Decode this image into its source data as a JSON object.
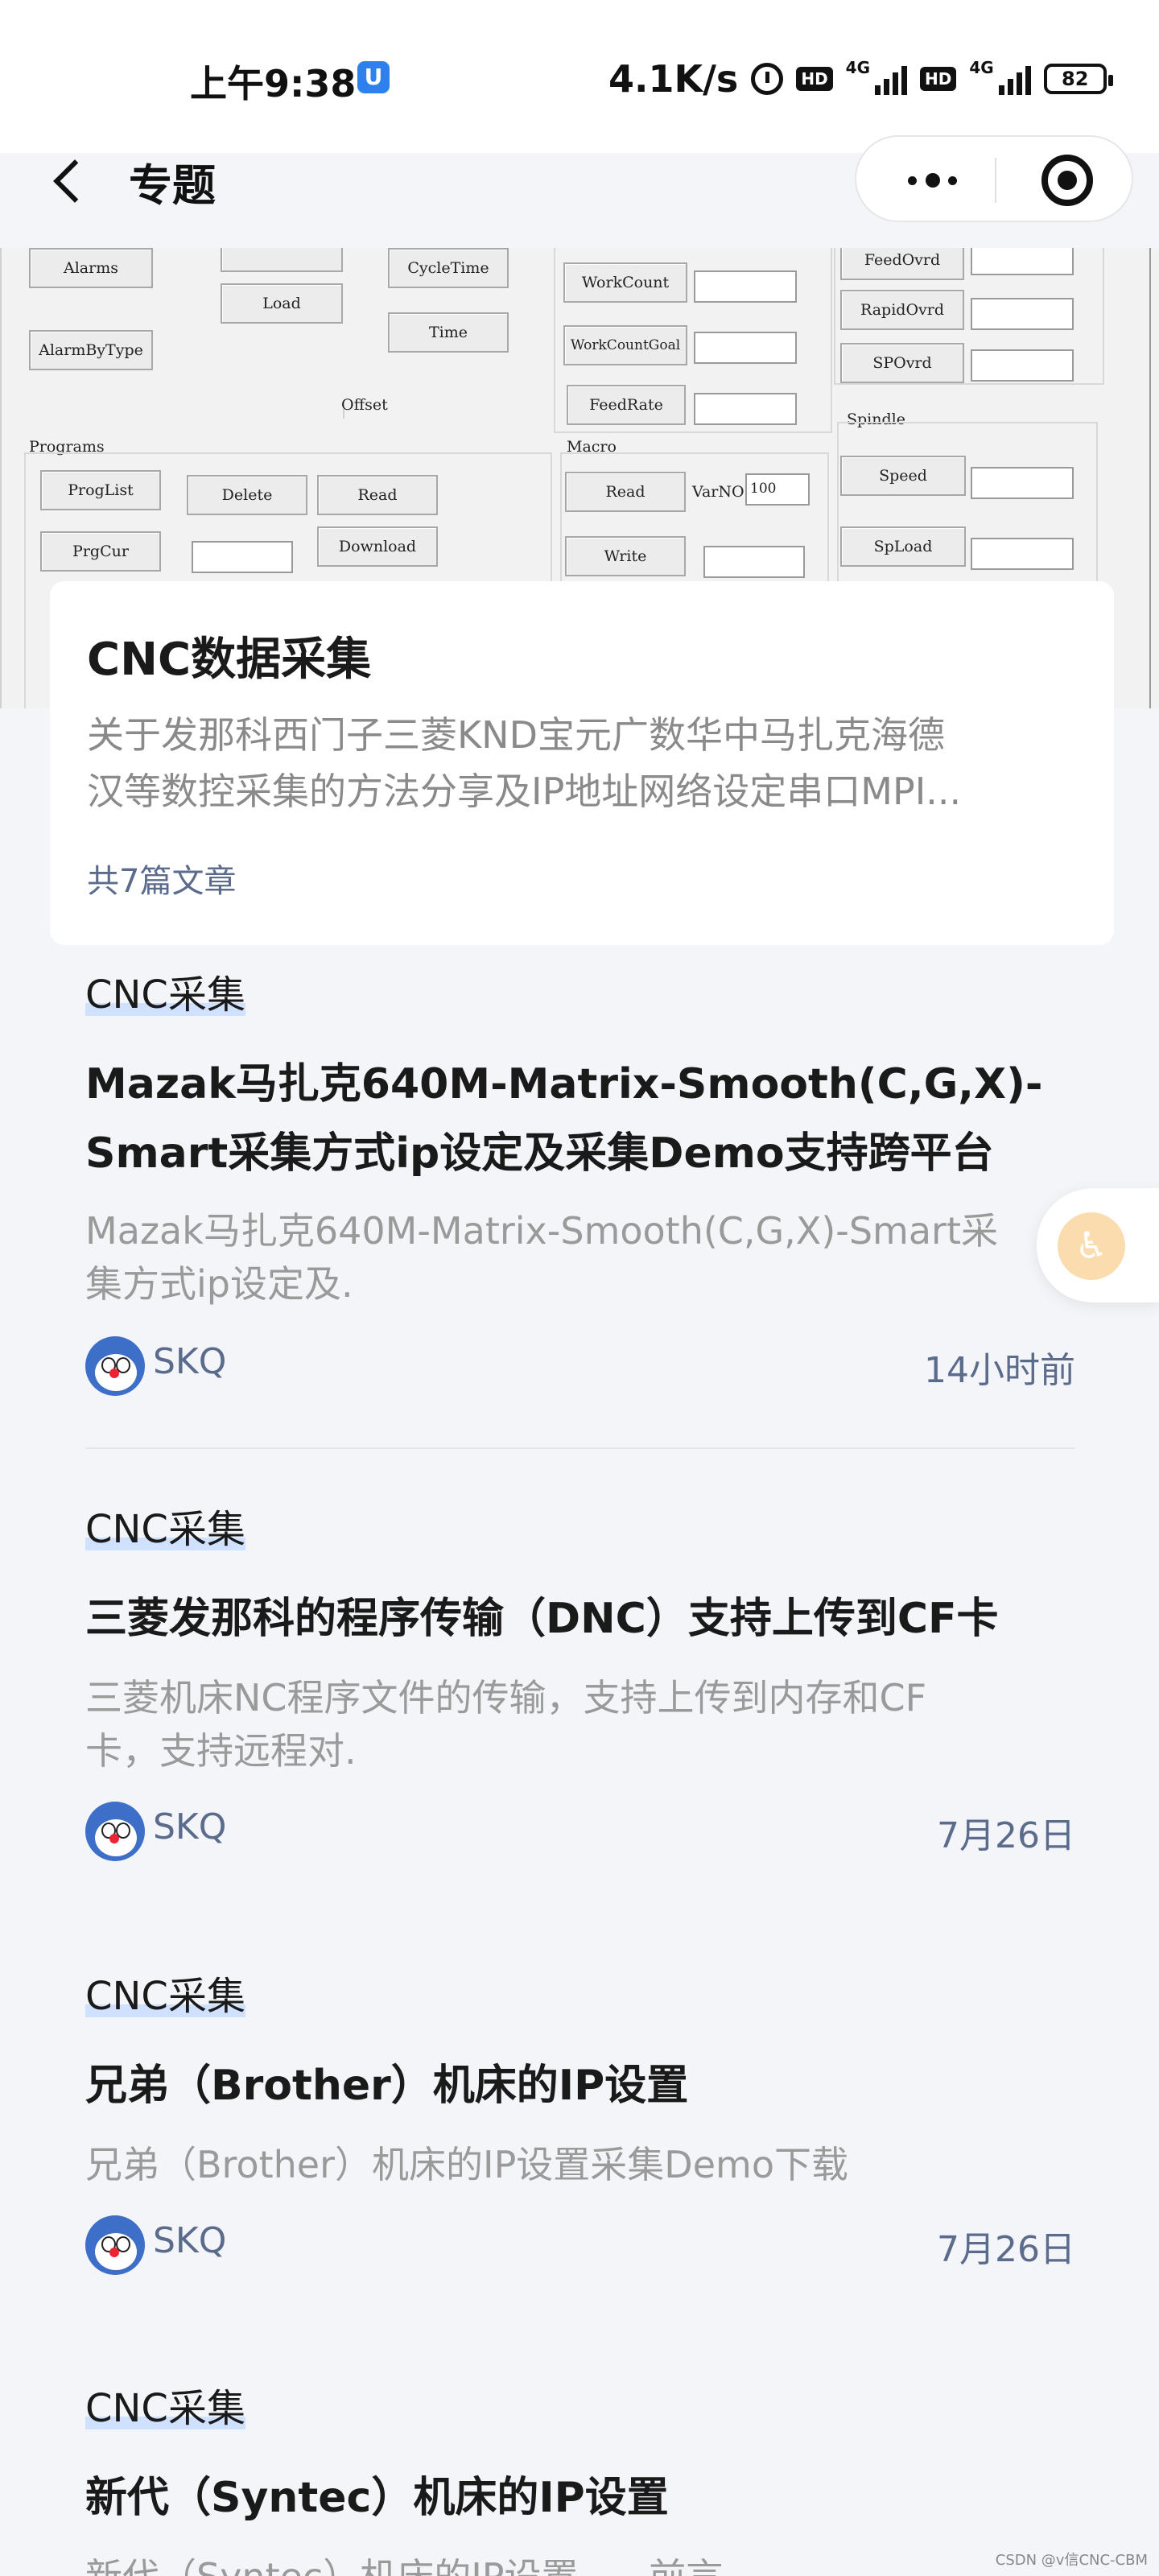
{
  "status_bar": {
    "time": "上午9:38",
    "app_badge": "U",
    "net_speed": "4.1K/s",
    "hd1": "HD",
    "net1": "4G",
    "hd2": "HD",
    "net2": "4G",
    "battery": "82"
  },
  "nav": {
    "title": "专题",
    "more_icon": "more-dots-icon",
    "close_icon": "target-circle-icon"
  },
  "banner": {
    "buttons": [
      "Alarms",
      "Load",
      "CycleTime",
      "WorkCount",
      "FeedOvrd",
      "RapidOvrd",
      "Time",
      "AlarmByType",
      "WorkCountGoal",
      "SPOvrd",
      "FeedRate",
      "ProgList",
      "Delete",
      "Read",
      "Speed",
      "Read",
      "PrgCur",
      "Download",
      "Write",
      "SpLoad"
    ],
    "labels": {
      "offset": "Offset",
      "programs": "Programs",
      "macro": "Macro",
      "spindle": "Spindle",
      "varno": "VarNO:",
      "varno_value": "100"
    }
  },
  "topic": {
    "title": "CNC数据采集",
    "desc_line1": "关于发那科西门子三菱KND宝元广数华中马扎克海德",
    "desc_line2": "汉等数控采集的方法分享及IP地址网络设定串口MPI...",
    "count": "共7篇文章"
  },
  "articles": [
    {
      "tag": "CNC采集",
      "title_line1": "Mazak马扎克640M-Matrix-Smooth(C,G,X)-",
      "title_line2": "Smart采集方式ip设定及采集Demo支持跨平台",
      "summary_line1": "Mazak马扎克640M-Matrix-Smooth(C,G,X)-Smart采",
      "summary_line2": "集方式ip设定及.",
      "author": "SKQ",
      "time": "14小时前"
    },
    {
      "tag": "CNC采集",
      "title_line1": "三菱发那科的程序传输（DNC）支持上传到CF卡",
      "summary_line1": "三菱机床NC程序文件的传输，支持上传到内存和CF",
      "summary_line2": "卡，支持远程对.",
      "author": "SKQ",
      "time": "7月26日"
    },
    {
      "tag": "CNC采集",
      "title_line1": "兄弟（Brother）机床的IP设置",
      "summary_line1": "兄弟（Brother）机床的IP设置采集Demo下载",
      "author": "SKQ",
      "time": "7月26日"
    },
    {
      "tag": "CNC采集",
      "title_line1": "新代（Syntec）机床的IP设置",
      "summary_line1": "新代（Syntec）机床的IP设置......前言"
    }
  ],
  "float_button": {
    "icon": "accessibility-icon",
    "glyph": "♿"
  },
  "watermark": "CSDN @v信CNC-CBM"
}
